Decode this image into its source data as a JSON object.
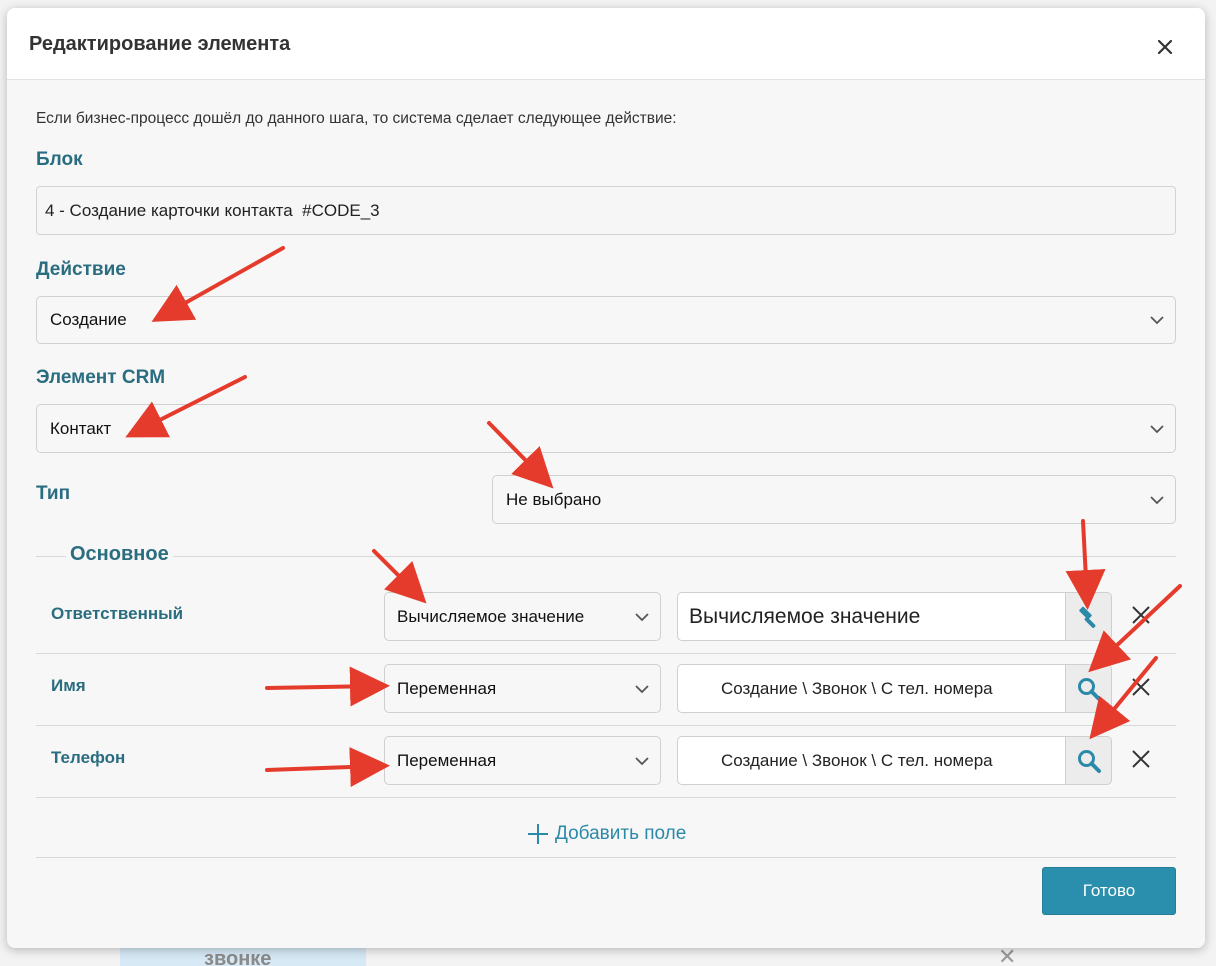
{
  "background": {
    "card_text": "звонке"
  },
  "dialog": {
    "title": "Редактирование элемента",
    "intro": "Если бизнес-процесс дошёл до данного шага, то система сделает следующее действие:",
    "block": {
      "label": "Блок",
      "value": "4 - Создание карточки контакта  #CODE_3"
    },
    "action": {
      "label": "Действие",
      "value": "Создание"
    },
    "crm_element": {
      "label": "Элемент CRM",
      "value": "Контакт"
    },
    "type": {
      "label": "Тип",
      "value": "Не выбрано"
    },
    "group": {
      "legend": "Основное",
      "rows": [
        {
          "label": "Ответственный",
          "mode": "Вычисляемое значение",
          "value": "Вычисляемое значение",
          "button_icon": "hammer-icon"
        },
        {
          "label": "Имя",
          "mode": "Переменная",
          "value": "Создание \\ Звонок \\ С тел. номера",
          "button_icon": "search-icon"
        },
        {
          "label": "Телефон",
          "mode": "Переменная",
          "value": "Создание \\ Звонок \\ С тел. номера",
          "button_icon": "search-icon"
        }
      ]
    },
    "add_field_label": "Добавить поле",
    "done_label": "Готово"
  },
  "colors": {
    "label_teal": "#2b6d80",
    "accent_blue": "#2a8fac",
    "annotation_red": "#e53b2c"
  }
}
